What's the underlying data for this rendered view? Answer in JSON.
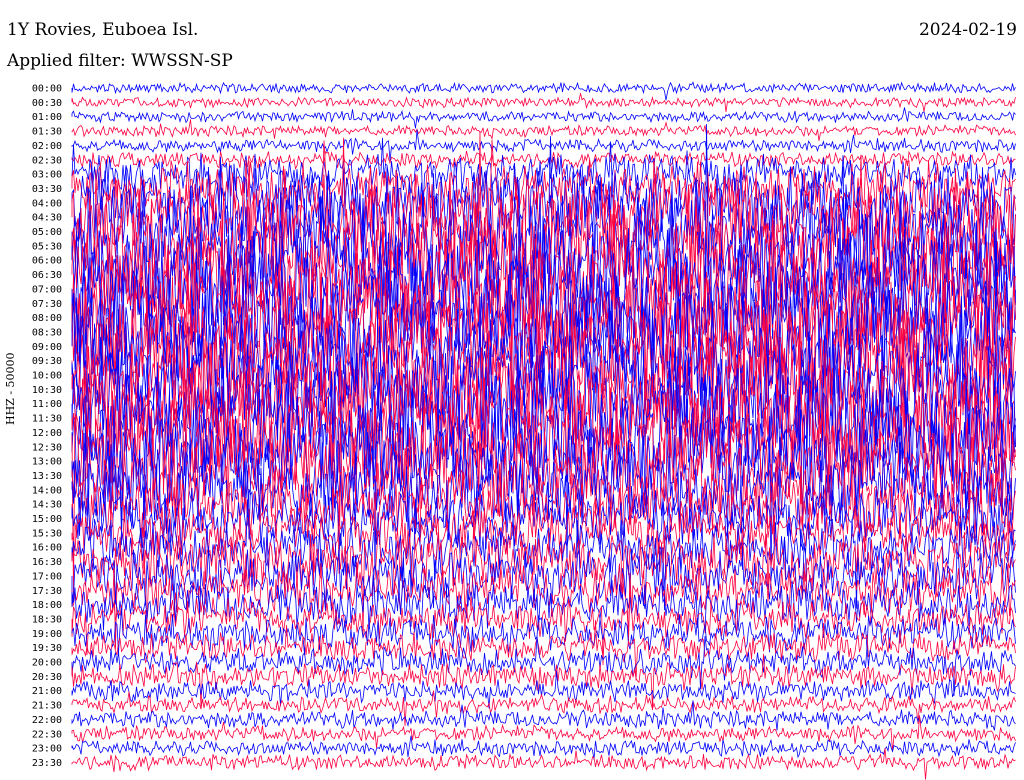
{
  "header": {
    "title": "1Y Rovies, Euboea Isl.",
    "filter": "Applied filter: WWSSN-SP",
    "date": "2024-02-19"
  },
  "chart_data": {
    "type": "line",
    "title": "1Y Rovies, Euboea Isl.",
    "subtitle": "Applied filter: WWSSN-SP",
    "date": "2024-02-19",
    "ylabel": "HHZ - 50000",
    "row_labels": [
      "00:00",
      "00:30",
      "01:00",
      "01:30",
      "02:00",
      "02:30",
      "03:00",
      "03:30",
      "04:00",
      "04:30",
      "05:00",
      "05:30",
      "06:00",
      "06:30",
      "07:00",
      "07:30",
      "08:00",
      "08:30",
      "09:00",
      "09:30",
      "10:00",
      "10:30",
      "11:00",
      "11:30",
      "12:00",
      "12:30",
      "13:00",
      "13:30",
      "14:00",
      "14:30",
      "15:00",
      "15:30",
      "16:00",
      "16:30",
      "17:00",
      "17:30",
      "18:00",
      "18:30",
      "19:00",
      "19:30",
      "20:00",
      "20:30",
      "21:00",
      "21:30",
      "22:00",
      "22:30",
      "23:00",
      "23:30"
    ],
    "series_colors": [
      "#0000ff",
      "#ff0040"
    ],
    "activity_level": [
      0.05,
      0.05,
      0.06,
      0.06,
      0.08,
      0.1,
      0.3,
      0.4,
      0.6,
      0.75,
      0.85,
      0.9,
      0.95,
      0.95,
      0.95,
      0.95,
      0.95,
      0.95,
      0.95,
      0.95,
      0.95,
      0.95,
      0.95,
      0.95,
      0.95,
      0.9,
      0.85,
      0.8,
      0.7,
      0.55,
      0.45,
      0.4,
      0.4,
      0.45,
      0.45,
      0.4,
      0.35,
      0.3,
      0.25,
      0.22,
      0.2,
      0.18,
      0.15,
      0.12,
      0.12,
      0.1,
      0.1,
      0.1
    ]
  }
}
